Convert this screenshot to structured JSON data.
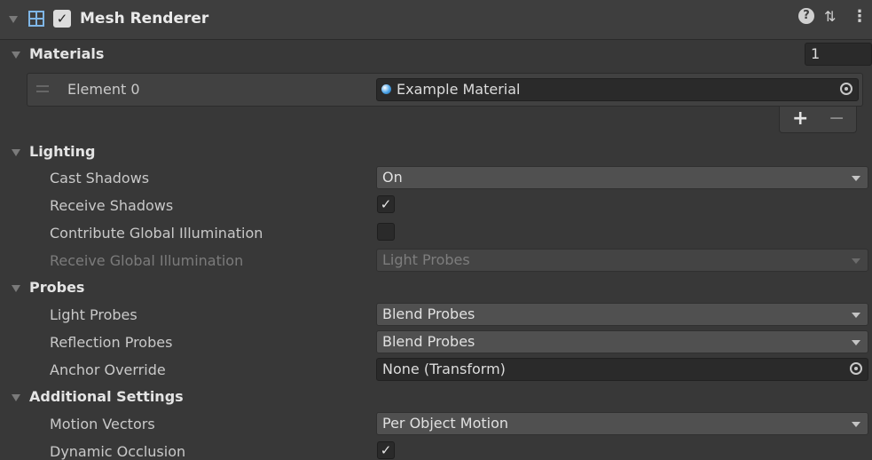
{
  "component": {
    "title": "Mesh Renderer",
    "enabled_check": "✓",
    "help_icon": "?",
    "presets_icon": "⇅",
    "menu_icon": "⋮"
  },
  "materials": {
    "label": "Materials",
    "size": "1",
    "element_label": "Element 0",
    "element_value": "Example Material",
    "add_label": "+",
    "remove_label": "−"
  },
  "lighting": {
    "label": "Lighting",
    "cast_shadows": {
      "label": "Cast Shadows",
      "value": "On"
    },
    "receive_shadows": {
      "label": "Receive Shadows",
      "checked": "✓"
    },
    "contribute_gi": {
      "label": "Contribute Global Illumination",
      "checked": ""
    },
    "receive_gi": {
      "label": "Receive Global Illumination",
      "value": "Light Probes"
    }
  },
  "probes": {
    "label": "Probes",
    "light_probes": {
      "label": "Light Probes",
      "value": "Blend Probes"
    },
    "reflection_probes": {
      "label": "Reflection Probes",
      "value": "Blend Probes"
    },
    "anchor_override": {
      "label": "Anchor Override",
      "value": "None (Transform)"
    }
  },
  "additional": {
    "label": "Additional Settings",
    "motion_vectors": {
      "label": "Motion Vectors",
      "value": "Per Object Motion"
    },
    "dynamic_occlusion": {
      "label": "Dynamic Occlusion",
      "checked": "✓"
    }
  },
  "colors": {
    "background": "#383838",
    "field": "#2a2a2a",
    "dropdown": "#505050",
    "text": "#d2d2d2",
    "material_icon": "#4aa3e8"
  }
}
